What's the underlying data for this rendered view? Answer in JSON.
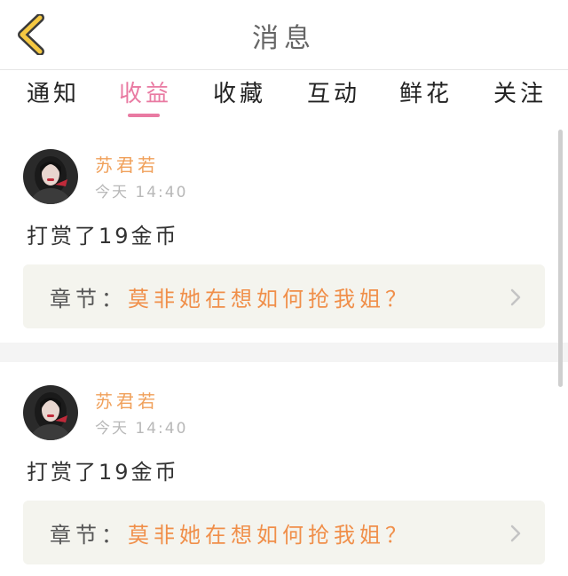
{
  "header": {
    "title": "消息"
  },
  "tabs": [
    {
      "label": "通知"
    },
    {
      "label": "收益"
    },
    {
      "label": "收藏"
    },
    {
      "label": "互动"
    },
    {
      "label": "鲜花"
    },
    {
      "label": "关注"
    }
  ],
  "active_tab": "收益",
  "messages": [
    {
      "user": "苏君若",
      "time": "今天 14:40",
      "action": "打赏了19金币",
      "chapter_label": "章节：",
      "chapter_title": "莫非她在想如何抢我姐？"
    },
    {
      "user": "苏君若",
      "time": "今天 14:40",
      "action": "打赏了19金币",
      "chapter_label": "章节：",
      "chapter_title": "莫非她在想如何抢我姐？"
    }
  ],
  "colors": {
    "accent": "#e97aa2",
    "user_name": "#f0a05a",
    "chapter_link": "#f08f4a",
    "back_icon": "#f5c842"
  },
  "icons": [
    "back-arrow-icon",
    "chevron-right-icon",
    "user-avatar"
  ]
}
